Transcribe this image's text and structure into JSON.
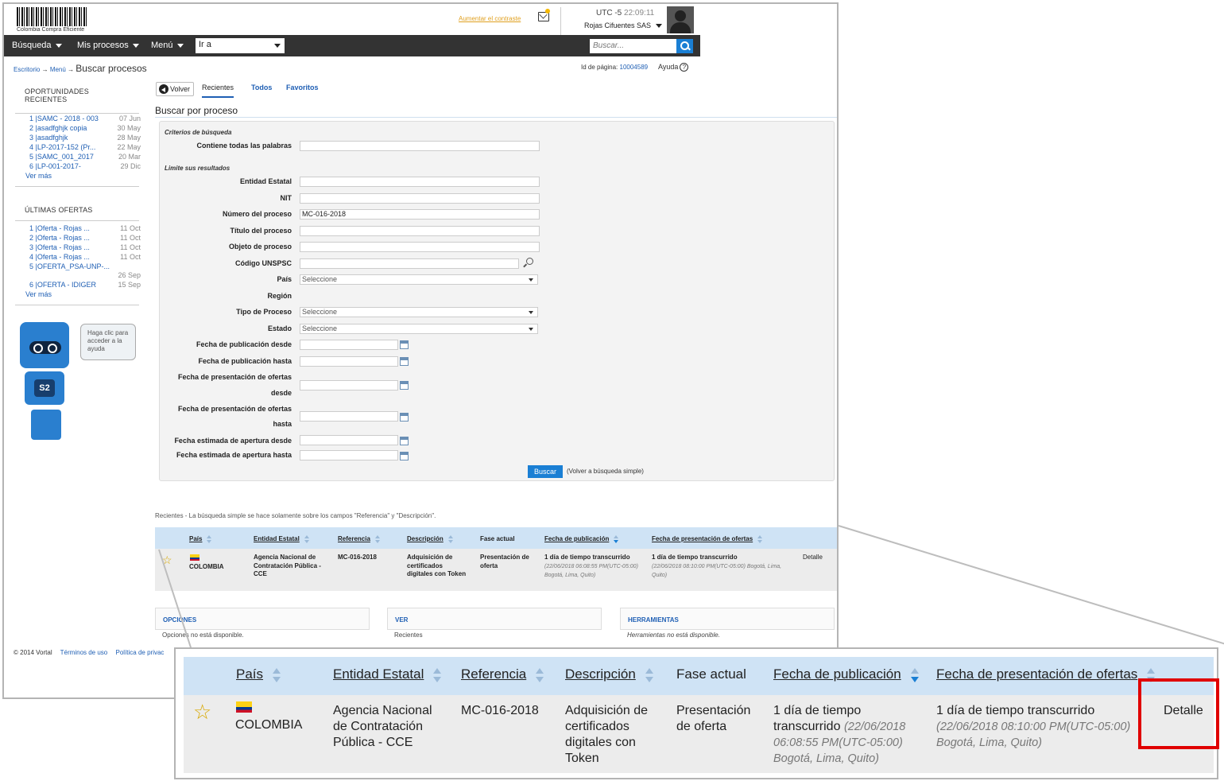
{
  "header": {
    "logo_text": "Colombia Compra Eficiente",
    "contrast_link": "Aumentar el contraste",
    "timezone": "UTC -5",
    "time": "22:09:11",
    "user_org": "Rojas Cifuentes SAS"
  },
  "nav": {
    "items": [
      "Búsqueda",
      "Mis procesos",
      "Menú"
    ],
    "goto_label": "Ir a",
    "search_placeholder": "Buscar..."
  },
  "breadcrumb": {
    "home": "Escritorio",
    "menu": "Menú",
    "arrow": "→",
    "current": "Buscar procesos"
  },
  "page_id": {
    "label": "Id de página:",
    "value": "10004589"
  },
  "help_label": "Ayuda",
  "sidebar": {
    "opportunities_title": "OPORTUNIDADES RECIENTES",
    "opportunities": [
      {
        "label": "1 |SAMC - 2018 - 003",
        "date": "07 Jun"
      },
      {
        "label": "2 |asadfghjk copia",
        "date": "30 May"
      },
      {
        "label": "3 |asadfghjk",
        "date": "28 May"
      },
      {
        "label": "4 |LP-2017-152 (Pr...",
        "date": "22 May"
      },
      {
        "label": "5 |SAMC_001_2017",
        "date": "20 Mar"
      },
      {
        "label": "6 |LP-001-2017-",
        "date": "29 Dic"
      }
    ],
    "see_more": "Ver más",
    "offers_title": "ÚLTIMAS OFERTAS",
    "offers": [
      {
        "label": "1 |Oferta - Rojas ...",
        "date": "11 Oct"
      },
      {
        "label": "2 |Oferta - Rojas ...",
        "date": "11 Oct"
      },
      {
        "label": "3 |Oferta - Rojas ...",
        "date": "11 Oct"
      },
      {
        "label": "4 |Oferta - Rojas ...",
        "date": "11 Oct"
      },
      {
        "label": "5 |OFERTA_PSA-UNP-...",
        "date": "26 Sep"
      },
      {
        "label": "6 |OFERTA - IDIGER",
        "date": "15 Sep"
      }
    ],
    "offers_see_more": "Ver más",
    "help_bubble": "Haga clic para acceder a la ayuda",
    "robot_badge": "S2"
  },
  "tabs": {
    "back": "Volver",
    "recent": "Recientes",
    "all": "Todos",
    "favorites": "Favoritos"
  },
  "page_title": "Buscar por proceso",
  "form": {
    "criteria_title": "Criterios de búsqueda",
    "all_words_label": "Contiene todas las palabras",
    "limit_title": "Limite sus resultados",
    "entity_label": "Entidad Estatal",
    "nit_label": "NIT",
    "process_number_label": "Número del proceso",
    "process_number_value": "MC-016-2018",
    "process_title_label": "Título del proceso",
    "process_object_label": "Objeto de proceso",
    "unspsc_label": "Código UNSPSC",
    "country_label": "País",
    "select_placeholder": "Seleccione",
    "region_label": "Región",
    "process_type_label": "Tipo de Proceso",
    "state_label": "Estado",
    "pub_from_label": "Fecha de publicación desde",
    "pub_to_label": "Fecha de publicación hasta",
    "offers_from_label_1": "Fecha de presentación de ofertas",
    "offers_from_label_2": "desde",
    "offers_to_label_1": "Fecha de presentación de ofertas",
    "offers_to_label_2": "hasta",
    "opening_from_label": "Fecha estimada de apertura desde",
    "opening_to_label": "Fecha estimada de apertura hasta",
    "search_button": "Buscar",
    "simple_search_link": "(Volver a búsqueda simple)"
  },
  "results": {
    "note": "Recientes - La búsqueda simple se hace solamente sobre los campos \"Referencia\" y \"Descripción\".",
    "columns": [
      "País",
      "Entidad Estatal",
      "Referencia",
      "Descripción",
      "Fase actual",
      "Fecha de publicación",
      "Fecha de presentación de ofertas"
    ],
    "row": {
      "country": "COLOMBIA",
      "entity": "Agencia Nacional de Contratación Pública - CCE",
      "reference": "MC-016-2018",
      "description": "Adquisición de certificados digitales con Token",
      "phase": "Presentación de oferta",
      "pub_main": "1 día de tiempo transcurrido",
      "pub_detail": "(22/06/2018 06:08:55 PM(UTC-05:00) Bogotá, Lima, Quito)",
      "offers_main": "1 día de tiempo transcurrido",
      "offers_detail": "(22/06/2018 08:10:00 PM(UTC-05:00) Bogotá, Lima, Quito)",
      "detail_link": "Detalle"
    }
  },
  "panels": {
    "options_title": "OPCIONES",
    "options_note": "Opciones no está disponible.",
    "view_title": "VER",
    "view_note": "Recientes",
    "tools_title": "HERRAMIENTAS",
    "tools_note": "Herramientas no está disponible."
  },
  "footer": {
    "copyright": "© 2014 Vortal",
    "terms": "Términos de uso",
    "privacy": "Política de privac"
  },
  "colors": {
    "accent": "#1a7fd4",
    "nav_bg": "#333333",
    "table_header": "#cfe3f5",
    "highlight": "#e00000"
  }
}
